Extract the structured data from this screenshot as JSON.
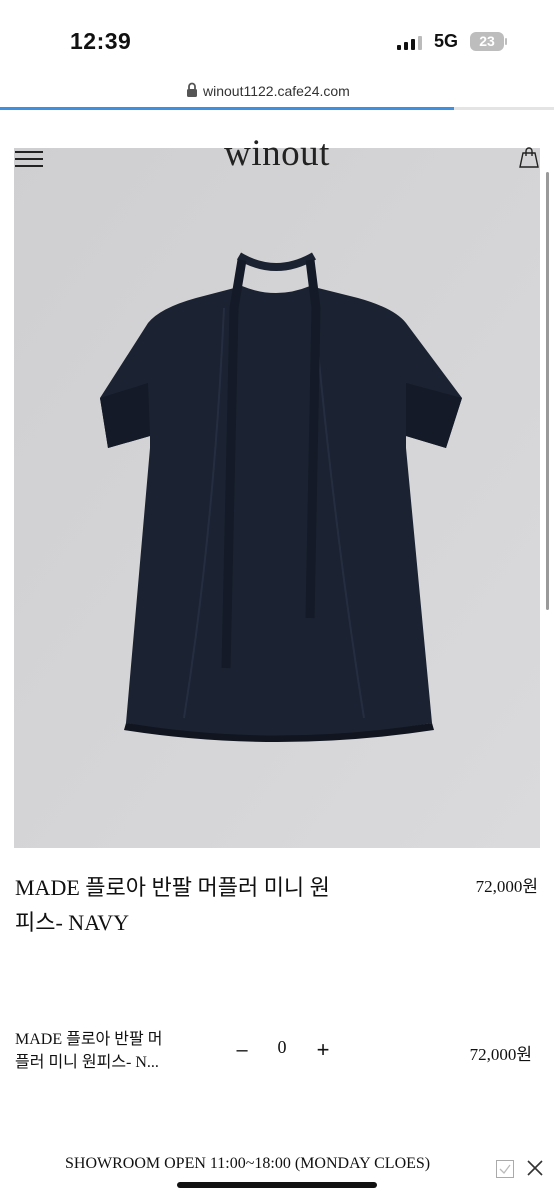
{
  "status_bar": {
    "time": "12:39",
    "network": "5G",
    "battery": "23"
  },
  "browser": {
    "url": "winout1122.cafe24.com",
    "load_progress_percent": 82
  },
  "header": {
    "logo": "winout",
    "menu_icon": "hamburger-menu-icon",
    "cart_icon": "shopping-bag-icon"
  },
  "product": {
    "image_alt": "navy short-sleeve mini dress with neck tie",
    "name_line1": "MADE 플로아 반팔 머플러 미니 원",
    "name_line2": "피스- NAVY",
    "price": "72,000원"
  },
  "option": {
    "name_line1": "MADE 플로아 반팔 머",
    "name_line2": "플러 미니 원피스- N...",
    "minus": "–",
    "quantity": "0",
    "plus": "+",
    "price": "72,000원"
  },
  "banner": {
    "text": "SHOWROOM OPEN 11:00~18:00 (MONDAY CLOES)"
  },
  "colors": {
    "accent": "#3d8fe0",
    "image_bg": "#d3d3d5",
    "dress": "#1b2231"
  }
}
